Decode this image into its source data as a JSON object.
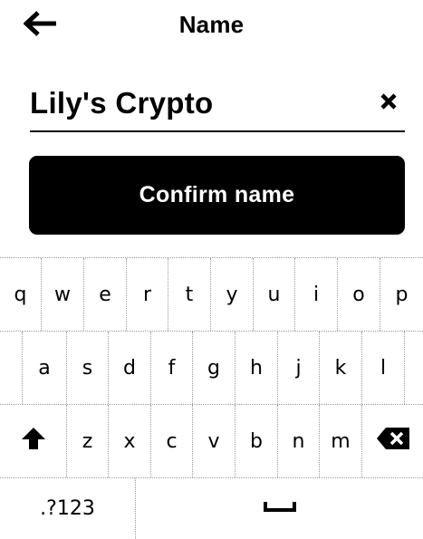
{
  "header": {
    "title": "Name",
    "back_icon": "arrow-left-icon"
  },
  "name_field": {
    "value": "Lily's Crypto",
    "clear_icon": "close-icon"
  },
  "confirm": {
    "label": "Confirm name"
  },
  "keyboard": {
    "row1": [
      "q",
      "w",
      "e",
      "r",
      "t",
      "y",
      "u",
      "i",
      "o",
      "p"
    ],
    "row2": [
      "a",
      "s",
      "d",
      "f",
      "g",
      "h",
      "j",
      "k",
      "l"
    ],
    "row3": [
      "z",
      "x",
      "c",
      "v",
      "b",
      "n",
      "m"
    ],
    "shift_icon": "shift-icon",
    "backspace_icon": "backspace-icon",
    "symbols_label": ".?123",
    "space_icon": "space-bar-icon"
  }
}
